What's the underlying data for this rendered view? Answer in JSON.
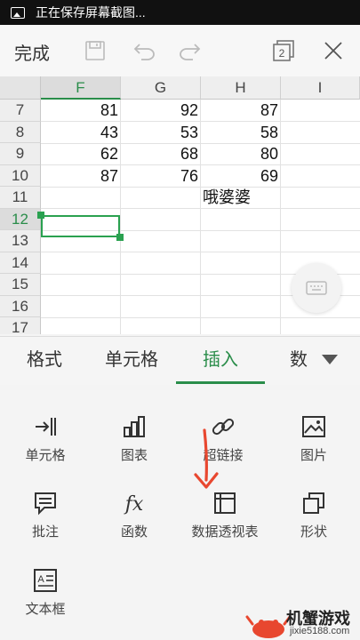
{
  "status_bar": {
    "text": "正在保存屏幕截图..."
  },
  "toolbar": {
    "done_label": "完成",
    "sheet_count": "2"
  },
  "grid": {
    "columns": [
      "F",
      "G",
      "H",
      "I"
    ],
    "active_column": "F",
    "rows": [
      "7",
      "8",
      "9",
      "10",
      "11",
      "12",
      "13",
      "14",
      "15",
      "16",
      "17"
    ],
    "active_row": "12",
    "cells": [
      [
        "81",
        "92",
        "87"
      ],
      [
        "43",
        "53",
        "58"
      ],
      [
        "62",
        "68",
        "80"
      ],
      [
        "87",
        "76",
        "69"
      ]
    ],
    "h11_text": "哦婆婆"
  },
  "tabs": [
    {
      "label": "格式"
    },
    {
      "label": "单元格"
    },
    {
      "label": "插入"
    },
    {
      "label": "数"
    }
  ],
  "active_tab": "插入",
  "insert_tools": [
    {
      "label": "单元格",
      "icon": "insert-cell-icon"
    },
    {
      "label": "图表",
      "icon": "chart-icon"
    },
    {
      "label": "超链接",
      "icon": "link-icon"
    },
    {
      "label": "图片",
      "icon": "picture-icon"
    },
    {
      "label": "批注",
      "icon": "comment-icon"
    },
    {
      "label": "函数",
      "icon": "function-icon",
      "glyph": "fx"
    },
    {
      "label": "数据透视表",
      "icon": "pivot-table-icon"
    },
    {
      "label": "形状",
      "icon": "shape-icon"
    },
    {
      "label": "文本框",
      "icon": "textbox-icon"
    }
  ],
  "watermark": {
    "name": "机蟹游戏",
    "url": "jixie5188.com"
  },
  "colors": {
    "accent": "#2a8d4a",
    "selection": "#2aa150",
    "arrow": "#e8472f"
  }
}
